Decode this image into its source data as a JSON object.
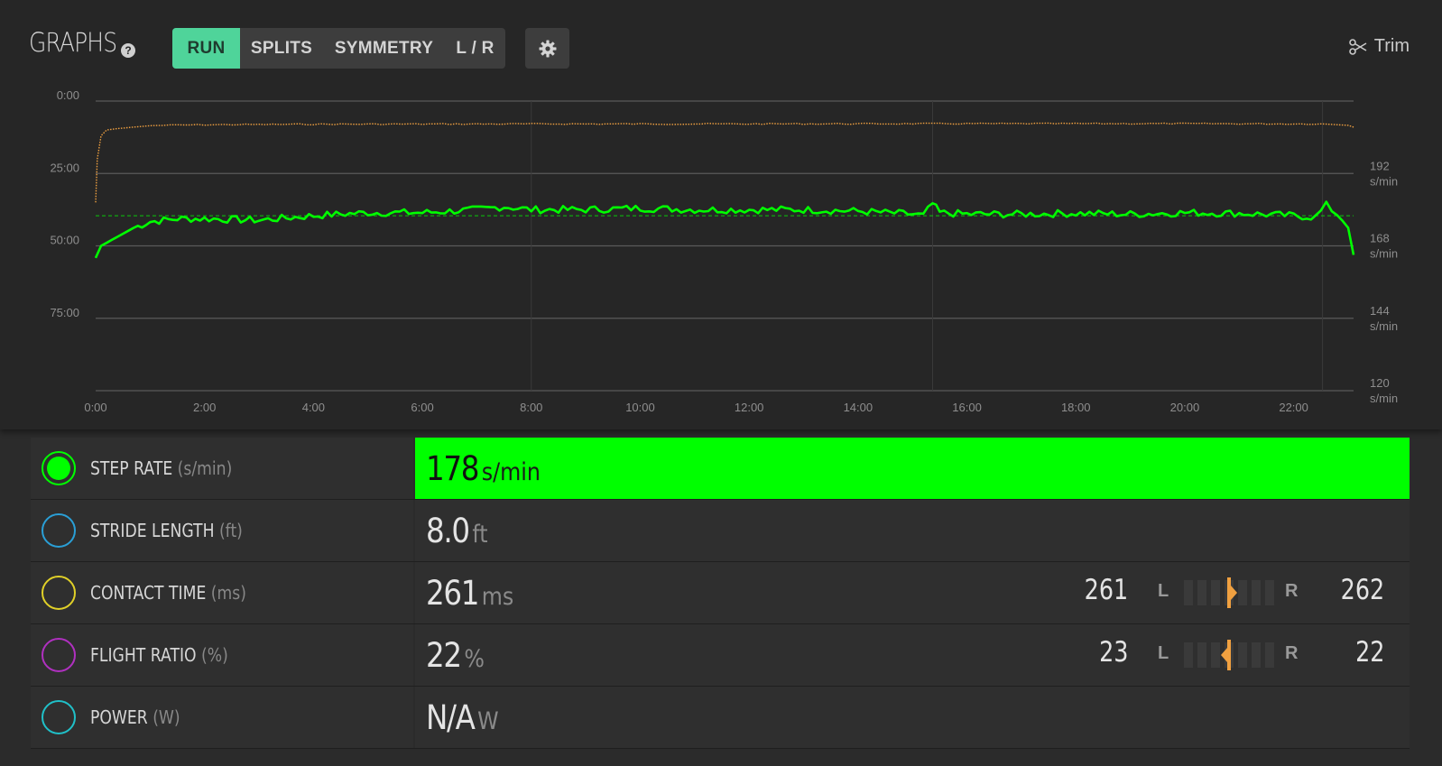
{
  "header": {
    "title": "GRAPHS",
    "help_icon": "question-circle-icon",
    "tabs": [
      {
        "label": "RUN",
        "active": true
      },
      {
        "label": "SPLITS",
        "active": false
      },
      {
        "label": "SYMMETRY",
        "active": false
      },
      {
        "label": "L / R",
        "active": false
      }
    ],
    "settings_icon": "gear-icon",
    "trim_icon": "scissors-icon",
    "trim_label": "Trim"
  },
  "chart_data": {
    "type": "line",
    "x_ticks": [
      "0:00",
      "2:00",
      "4:00",
      "6:00",
      "8:00",
      "10:00",
      "12:00",
      "14:00",
      "16:00",
      "18:00",
      "20:00",
      "22:00"
    ],
    "x_range_minutes": [
      0,
      23.1
    ],
    "left_axis": {
      "ticks": [
        "0:00",
        "25:00",
        "50:00",
        "75:00"
      ],
      "range": [
        0,
        100
      ]
    },
    "right_axis": {
      "ticks": [
        "192 s/min",
        "168 s/min",
        "144 s/min",
        "120 s/min"
      ],
      "range": [
        120,
        216
      ]
    },
    "grid": true,
    "vertical_markers_minutes": [
      8.0,
      15.37,
      22.53
    ],
    "series": [
      {
        "metric": "step rate",
        "axis": "right",
        "color": "#00ff00",
        "average": 178,
        "x": [
          0,
          0.1,
          0.3,
          0.5,
          0.7,
          1.0,
          1.5,
          2,
          3,
          4,
          5,
          6,
          7,
          7.5,
          8,
          9,
          10,
          11,
          12,
          13,
          14,
          15,
          15.2,
          15.37,
          15.5,
          16,
          17,
          18,
          19,
          20,
          21,
          22,
          22.4,
          22.6,
          22.8,
          23,
          23.1
        ],
        "y": [
          164,
          168,
          170,
          172,
          174,
          176,
          177,
          177,
          176.5,
          178,
          179,
          179,
          180,
          181,
          180,
          180,
          180.5,
          180,
          180,
          180,
          179.5,
          178.5,
          178,
          182,
          179,
          178.5,
          178.5,
          178.8,
          178.5,
          179,
          178.8,
          178,
          177.5,
          181.5,
          178.5,
          174,
          165
        ]
      },
      {
        "metric": "pace",
        "axis": "left",
        "color": "#f0a040",
        "style": "dotted",
        "x": [
          0,
          0.03,
          0.1,
          0.2,
          0.4,
          0.7,
          1.0,
          1.5,
          2,
          4,
          8,
          12,
          16,
          20,
          22.5,
          23,
          23.1
        ],
        "y": [
          35,
          20,
          12,
          10,
          9.5,
          9,
          8.5,
          8.3,
          8.2,
          8,
          7.9,
          7.9,
          7.8,
          7.8,
          7.9,
          8.2,
          9
        ]
      }
    ]
  },
  "metrics": [
    {
      "name": "STEP RATE",
      "unit_label": "(s/min)",
      "value": "178",
      "unit": "s/min",
      "color": "#00ff00",
      "selected": true,
      "highlight": true
    },
    {
      "name": "STRIDE LENGTH",
      "unit_label": "(ft)",
      "value": "8.0",
      "unit": "ft",
      "color": "#2a9fd6",
      "selected": false
    },
    {
      "name": "CONTACT TIME",
      "unit_label": "(ms)",
      "value": "261",
      "unit": "ms",
      "color": "#e0d028",
      "selected": false,
      "symmetry": {
        "left": "261",
        "right": "262",
        "L": "L",
        "R": "R",
        "direction": "right"
      }
    },
    {
      "name": "FLIGHT RATIO",
      "unit_label": "(%)",
      "value": "22",
      "unit": "%",
      "color": "#b030c0",
      "selected": false,
      "symmetry": {
        "left": "23",
        "right": "22",
        "L": "L",
        "R": "R",
        "direction": "left"
      }
    },
    {
      "name": "POWER",
      "unit_label": "(W)",
      "value": "N/A",
      "unit": "W",
      "color": "#20c0c8",
      "selected": false
    }
  ]
}
